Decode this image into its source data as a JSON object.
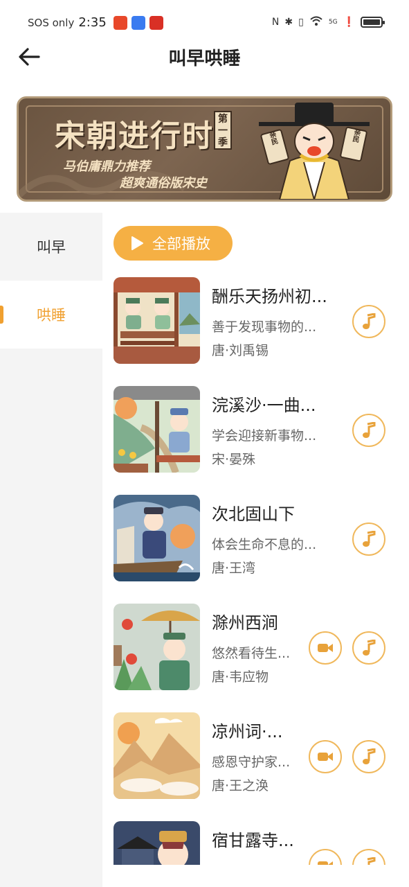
{
  "status_bar": {
    "carrier": "SOS only",
    "time": "2:35",
    "network": "5G",
    "battery_level": 0.85,
    "app_icon_colors": [
      "#e8482a",
      "#3a7bf0",
      "#d93025"
    ]
  },
  "header": {
    "title": "叫早哄睡"
  },
  "banner": {
    "title": "宋朝进行时",
    "season_badge": "第一季",
    "subtitle_line1": "马伯庸鼎力推荐",
    "subtitle_line2": "超爽通俗版宋史",
    "card_left": "亲民",
    "card_right": "亲民"
  },
  "sidebar": {
    "items": [
      {
        "label": "叫早",
        "active": false
      },
      {
        "label": "哄睡",
        "active": true
      }
    ]
  },
  "play_all": {
    "label": "全部播放"
  },
  "poems": [
    {
      "title": "酬乐天扬州初...",
      "desc": "善于发现事物的...",
      "author": "唐·刘禹锡",
      "has_video": false,
      "thumb_icon": "two-scholars-tea-illustration"
    },
    {
      "title": "浣溪沙·一曲...",
      "desc": "学会迎接新事物...",
      "author": "宋·晏殊",
      "has_video": false,
      "thumb_icon": "scholar-pavilion-illustration"
    },
    {
      "title": "次北固山下",
      "desc": "体会生命不息的...",
      "author": "唐·王湾",
      "has_video": false,
      "thumb_icon": "boat-traveler-illustration"
    },
    {
      "title": "滁州西涧",
      "desc": "悠然看待生...",
      "author": "唐·韦应物",
      "has_video": true,
      "thumb_icon": "umbrella-scholar-illustration"
    },
    {
      "title": "凉州词·...",
      "desc": "感恩守护家...",
      "author": "唐·王之涣",
      "has_video": true,
      "thumb_icon": "desert-mountains-illustration"
    },
    {
      "title": "宿甘露寺...",
      "desc": "",
      "author": "",
      "has_video": true,
      "thumb_icon": "temple-scholar-illustration"
    }
  ],
  "colors": {
    "accent": "#f0a030",
    "play_all_bg": "#f5b044",
    "icon_orange": "#e8a23a",
    "sidebar_bg": "#f4f4f4"
  }
}
